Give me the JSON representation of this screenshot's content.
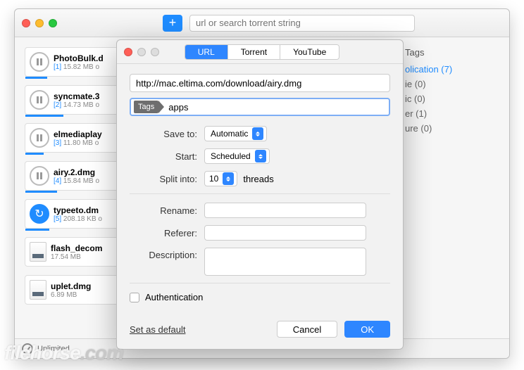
{
  "toolbar": {
    "search_placeholder": "url or search torrent string"
  },
  "downloads": [
    {
      "icon": "pause",
      "name": "PhotoBulk.d",
      "idx": "[1]",
      "meta": "15.82 MB o",
      "progress": 22
    },
    {
      "icon": "pause",
      "name": "syncmate.3",
      "idx": "[2]",
      "meta": "14.73 MB o",
      "progress": 38
    },
    {
      "icon": "pause",
      "name": "elmediaplay",
      "idx": "[3]",
      "meta": "11.80 MB o",
      "progress": 18
    },
    {
      "icon": "pause",
      "name": "airy.2.dmg",
      "idx": "[4]",
      "meta": "15.84 MB o",
      "progress": 32
    },
    {
      "icon": "refresh",
      "name": "typeeto.dm",
      "idx": "[5]",
      "meta": "208.18 KB o",
      "progress": 24
    },
    {
      "icon": "doc",
      "name": "flash_decom",
      "idx": "",
      "meta": "17.54 MB",
      "progress": 0
    },
    {
      "icon": "doc",
      "name": "uplet.dmg",
      "idx": "",
      "meta": "6.89 MB",
      "progress": 0
    }
  ],
  "sidebar": {
    "header": "Tags",
    "items": [
      {
        "label": "olication (7)",
        "active": true
      },
      {
        "label": "ie (0)",
        "active": false
      },
      {
        "label": "ic (0)",
        "active": false
      },
      {
        "label": "er (1)",
        "active": false
      },
      {
        "label": "ure (0)",
        "active": false
      }
    ]
  },
  "status": {
    "label": "Unlimited"
  },
  "dialog": {
    "tabs": {
      "url": "URL",
      "torrent": "Torrent",
      "youtube": "YouTube"
    },
    "url_value": "http://mac.eltima.com/download/airy.dmg",
    "tags_label": "Tags",
    "tags_value": "apps",
    "labels": {
      "save_to": "Save to:",
      "start": "Start:",
      "split": "Split into:",
      "threads": "threads",
      "rename": "Rename:",
      "referer": "Referer:",
      "description": "Description:"
    },
    "save_to_value": "Automatic",
    "start_value": "Scheduled",
    "split_value": "10",
    "auth_label": "Authentication",
    "set_default": "Set as default",
    "cancel": "Cancel",
    "ok": "OK"
  },
  "watermark": {
    "a": "filehorse",
    "b": ".com"
  }
}
